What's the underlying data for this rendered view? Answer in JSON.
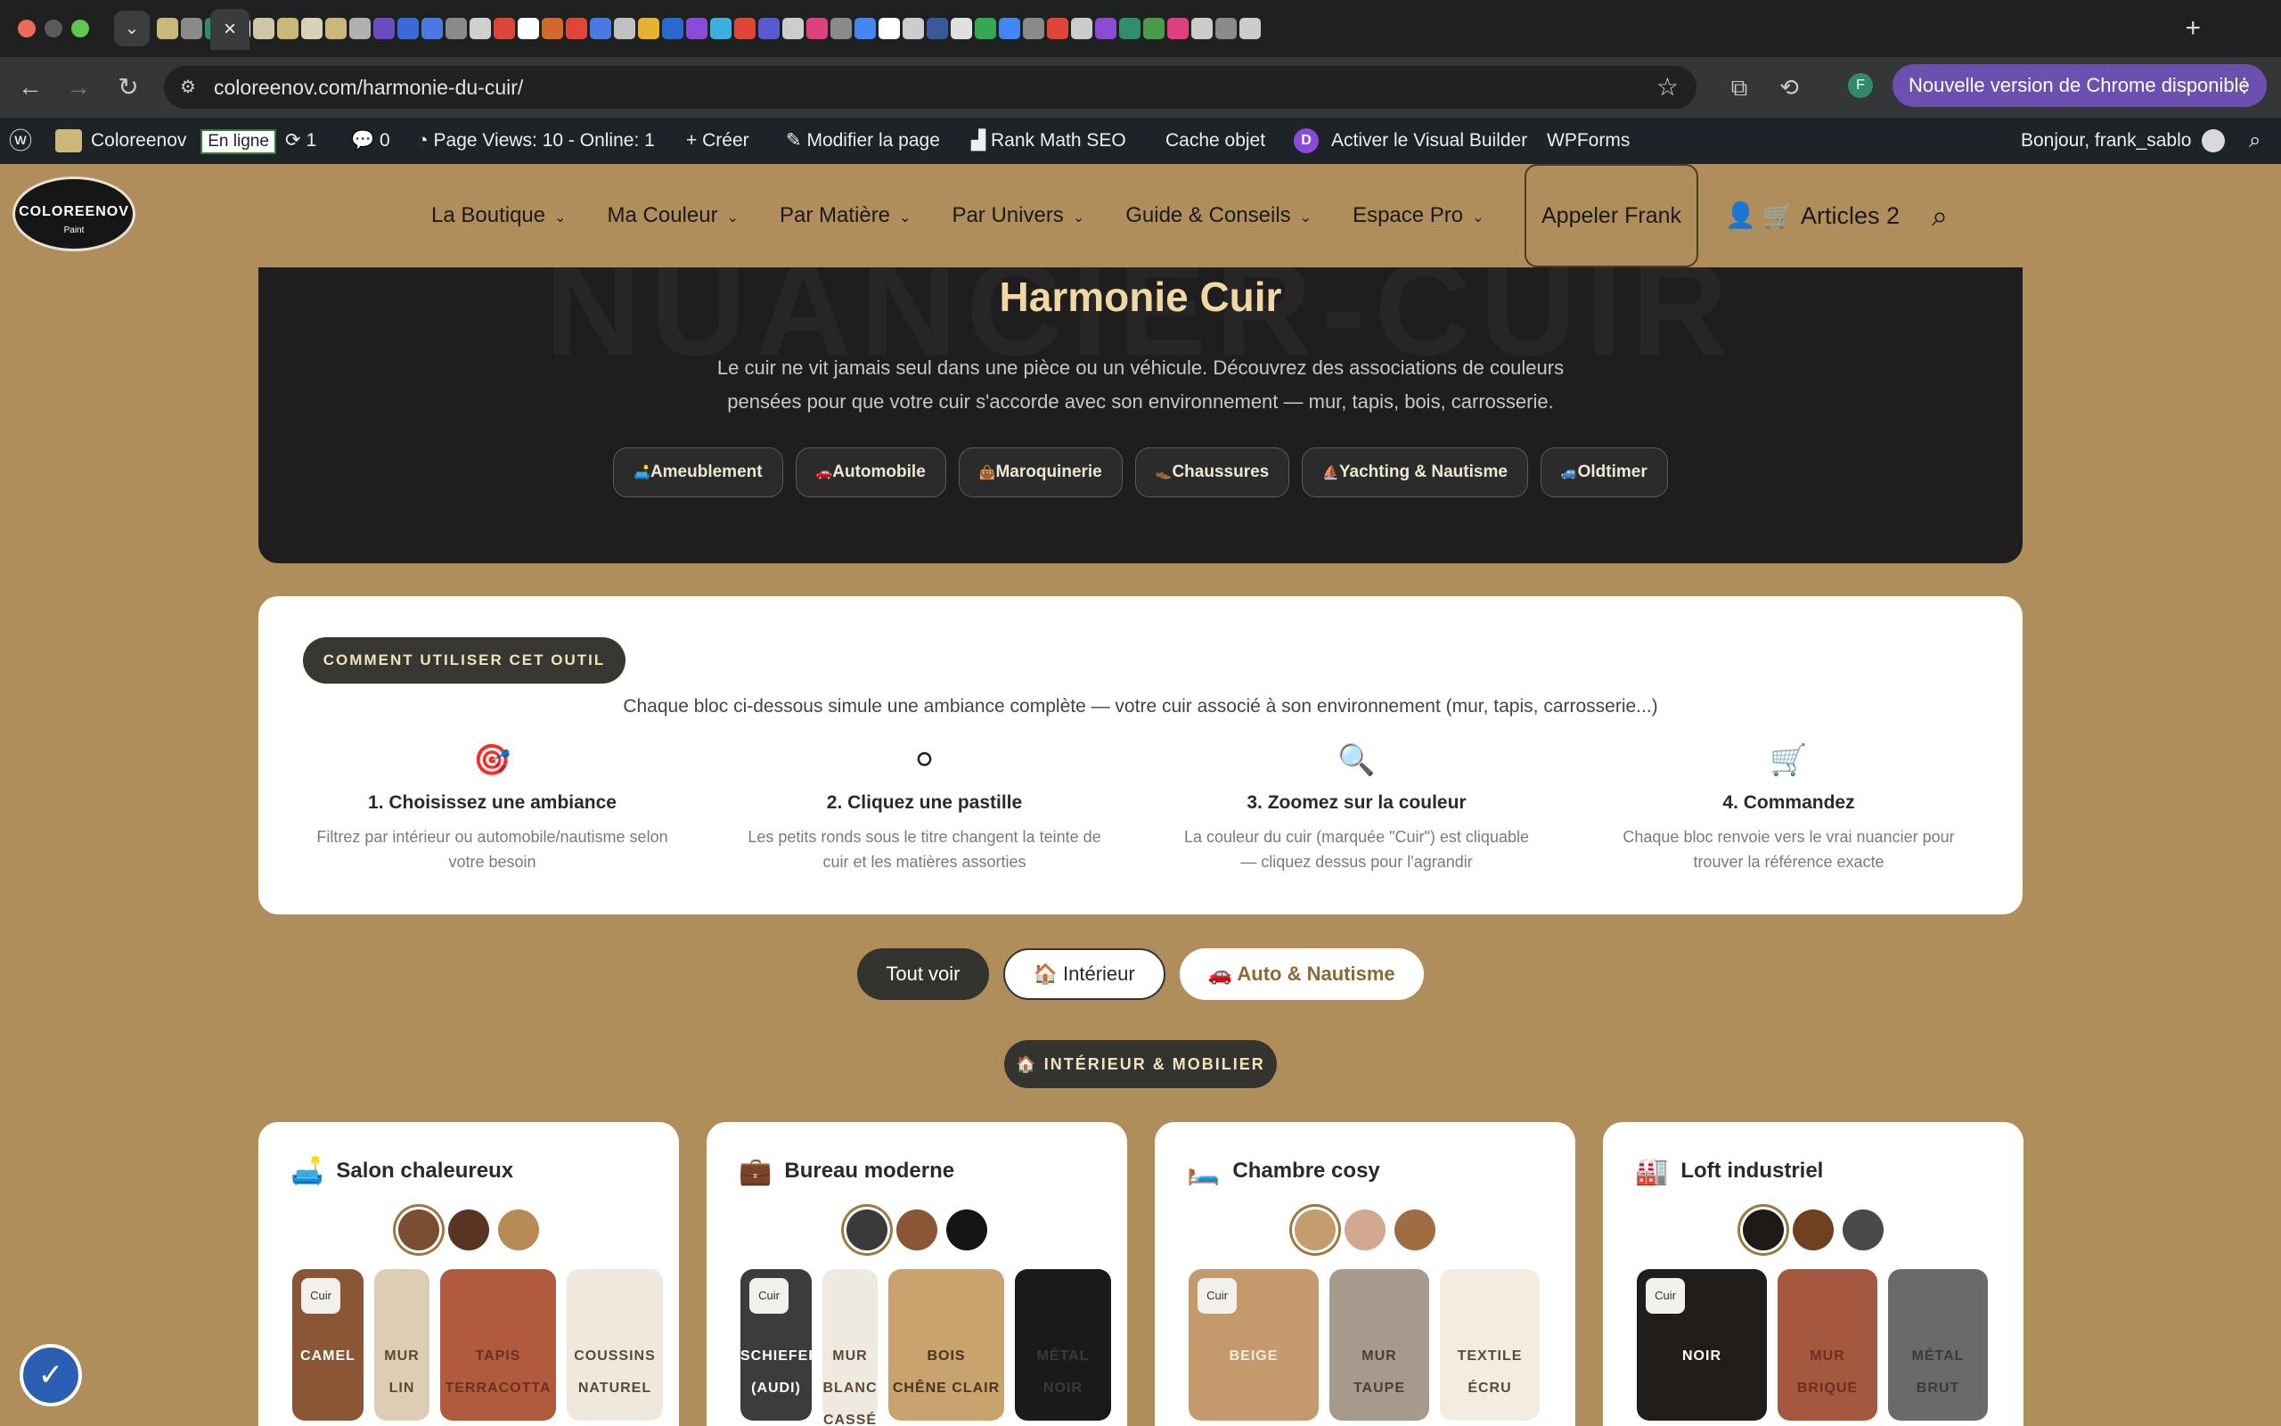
{
  "browser": {
    "url": "coloreenov.com/harmonie-du-cuir/",
    "update_label": "Nouvelle version de Chrome disponible",
    "profile_initial": "F"
  },
  "wp_admin": {
    "site": "Coloreenov",
    "online_badge": "En ligne",
    "updates_count": "1",
    "comments_count": "0",
    "page_views": "Page Views: 10 - Online: 1",
    "create": "Créer",
    "edit_page": "Modifier la page",
    "rank_math": "Rank Math SEO",
    "cache": "Cache objet",
    "divi_badge": "D",
    "visual_builder": "Activer le Visual Builder",
    "wpforms": "WPForms",
    "greeting": "Bonjour, frank_sablo"
  },
  "header": {
    "logo_text": "COLOREENOV",
    "logo_sub": "Paint",
    "menu": [
      {
        "label": "La Boutique"
      },
      {
        "label": "Ma Couleur"
      },
      {
        "label": "Par Matière"
      },
      {
        "label": "Par Univers"
      },
      {
        "label": "Guide & Conseils"
      },
      {
        "label": "Espace Pro"
      }
    ],
    "call_button": "Appeler Frank",
    "cart_label": "Articles 2"
  },
  "hero": {
    "bg_word": "NUANCIER-CUIR",
    "title": "Harmonie Cuir",
    "text_line1": "Le cuir ne vit jamais seul dans une pièce ou un véhicule. Découvrez des associations de couleurs",
    "text_line2": "pensées pour que votre cuir s'accorde avec son environnement — mur, tapis, bois, carrosserie.",
    "pills": [
      {
        "icon": "🛋️",
        "label": "Ameublement"
      },
      {
        "icon": "🚗",
        "label": "Automobile"
      },
      {
        "icon": "👜",
        "label": "Maroquinerie"
      },
      {
        "icon": "👞",
        "label": "Chaussures"
      },
      {
        "icon": "⛵",
        "label": "Yachting & Nautisme"
      },
      {
        "icon": "🚙",
        "label": "Oldtimer"
      }
    ]
  },
  "howto": {
    "badge": "COMMENT UTILISER CET OUTIL",
    "intro": "Chaque bloc ci-dessous simule une ambiance complète — votre cuir associé à son environnement (mur, tapis, carrosserie...)",
    "steps": [
      {
        "icon": "🎯",
        "title": "1. Choisissez une ambiance",
        "desc": "Filtrez par intérieur ou automobile/nautisme selon votre besoin"
      },
      {
        "icon": "⚪",
        "title": "2. Cliquez une pastille",
        "desc": "Les petits ronds sous le titre changent la teinte de cuir et les matières assorties"
      },
      {
        "icon": "🔍",
        "title": "3. Zoomez sur la couleur",
        "desc": "La couleur du cuir (marquée \"Cuir\") est cliquable — cliquez dessus pour l'agrandir"
      },
      {
        "icon": "🛒",
        "title": "4. Commandez",
        "desc": "Chaque bloc renvoie vers le vrai nuancier pour trouver la référence exacte"
      }
    ]
  },
  "filters": {
    "all": "Tout voir",
    "interior": "🏠 Intérieur",
    "auto": "🚗 Auto & Nautisme"
  },
  "section_label": "🏠 INTÉRIEUR & MOBILIER",
  "cuir_tag": "Cuir",
  "cards": [
    {
      "icon": "🛋️",
      "title": "Salon chaleureux",
      "dots": [
        "#7a4e32",
        "#5a3422",
        "#b88a54"
      ],
      "swatches": [
        {
          "l1": "CAMEL",
          "l2": "",
          "color": "#8a5636",
          "text": "#ffffff"
        },
        {
          "l1": "MUR",
          "l2": "LIN",
          "color": "#dccdb4",
          "text": "#5a4a36"
        },
        {
          "l1": "TAPIS",
          "l2": "TERRACOTTA",
          "color": "#b05a3e",
          "text": "#6e2f1e"
        },
        {
          "l1": "COUSSINS",
          "l2": "NATUREL",
          "color": "#efe8dc",
          "text": "#5a4a36"
        }
      ]
    },
    {
      "icon": "💼",
      "title": "Bureau moderne",
      "dots": [
        "#3a3a3a",
        "#8a5636",
        "#151515"
      ],
      "swatches": [
        {
          "l1": "SCHIEFER",
          "l2": "(AUDI)",
          "color": "#3c3c3c",
          "text": "#ffffff"
        },
        {
          "l1": "MUR",
          "l2": "BLANC CASSÉ",
          "color": "#eeeae2",
          "text": "#5a4a36"
        },
        {
          "l1": "BOIS",
          "l2": "CHÊNE CLAIR",
          "color": "#c9a36e",
          "text": "#4a3422"
        },
        {
          "l1": "MÉTAL",
          "l2": "NOIR",
          "color": "#1a1a1a",
          "text": "#3a3a3a"
        }
      ]
    },
    {
      "icon": "🛏️",
      "title": "Chambre cosy",
      "dots": [
        "#c49c6e",
        "#d2a890",
        "#a06c42"
      ],
      "swatches": [
        {
          "l1": "BEIGE",
          "l2": "",
          "color": "#c49a6c",
          "text": "#f5ecd8"
        },
        {
          "l1": "MUR",
          "l2": "TAUPE",
          "color": "#a69a8c",
          "text": "#4a4036"
        },
        {
          "l1": "TEXTILE",
          "l2": "ÉCRU",
          "color": "#f3ece0",
          "text": "#5a4a36"
        }
      ]
    },
    {
      "icon": "🏭",
      "title": "Loft industriel",
      "dots": [
        "#1e1a18",
        "#704020",
        "#4a4a4a"
      ],
      "swatches": [
        {
          "l1": "NOIR",
          "l2": "",
          "color": "#211d1b",
          "text": "#ffffff"
        },
        {
          "l1": "MUR",
          "l2": "BRIQUE",
          "color": "#a45840",
          "text": "#6e2f1e"
        },
        {
          "l1": "MÉTAL",
          "l2": "BRUT",
          "color": "#6a6a6a",
          "text": "#3a3a3a"
        }
      ]
    }
  ]
}
